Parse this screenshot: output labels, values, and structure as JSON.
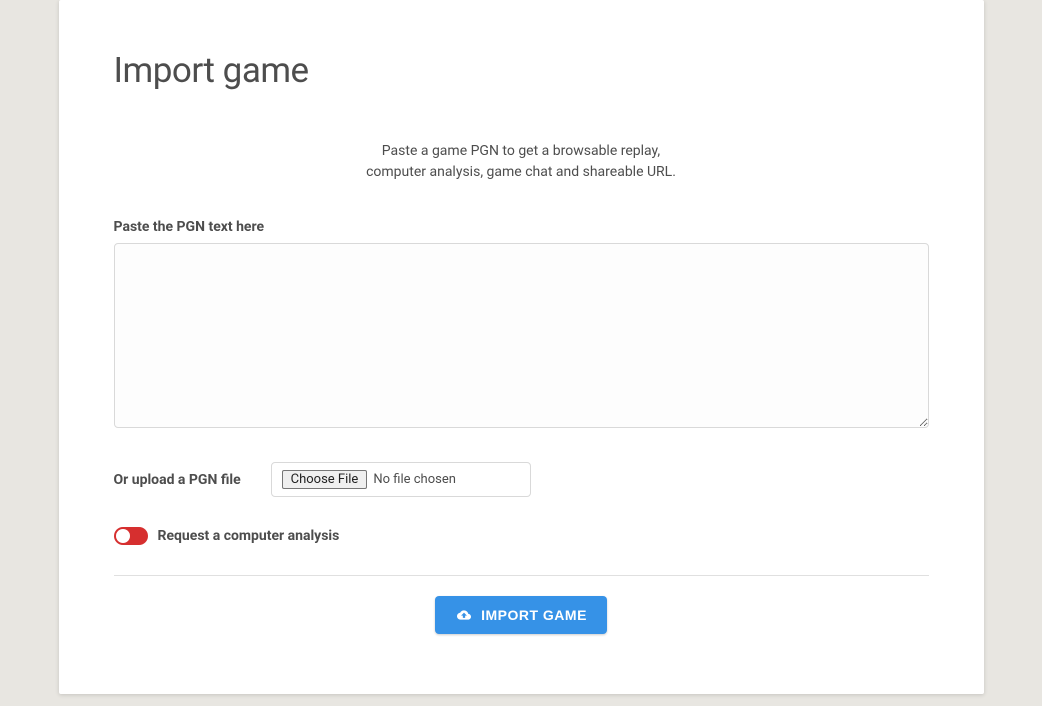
{
  "title": "Import game",
  "intro_line1": "Paste a game PGN to get a browsable replay,",
  "intro_line2": "computer analysis, game chat and shareable URL.",
  "form": {
    "pgn_label": "Paste the PGN text here",
    "pgn_value": "",
    "upload_label": "Or upload a PGN file",
    "choose_file_label": "Choose File",
    "file_status": "No file chosen",
    "analysis_label": "Request a computer analysis",
    "analysis_on": false,
    "submit_label": "IMPORT GAME"
  },
  "colors": {
    "accent": "#3692e7",
    "toggle_off": "#d62f2f"
  }
}
